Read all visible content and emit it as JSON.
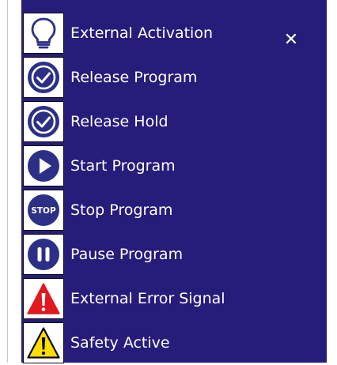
{
  "panel": {
    "background": "#261c79",
    "close_label": "✕",
    "items": [
      {
        "label": "External Activation",
        "icon": "lightbulb-icon"
      },
      {
        "label": "Release Program",
        "icon": "check-circle-icon"
      },
      {
        "label": "Release Hold",
        "icon": "check-circle-icon"
      },
      {
        "label": "Start Program",
        "icon": "play-icon"
      },
      {
        "label": "Stop Program",
        "icon": "stop-sign-icon"
      },
      {
        "label": "Pause Program",
        "icon": "pause-icon"
      },
      {
        "label": "External Error Signal",
        "icon": "error-warning-icon"
      },
      {
        "label": "Safety Active",
        "icon": "caution-warning-icon"
      }
    ]
  },
  "colors": {
    "icon_blue": "#2b2f86",
    "error_red": "#e0191e",
    "caution_yellow": "#ffde00"
  }
}
